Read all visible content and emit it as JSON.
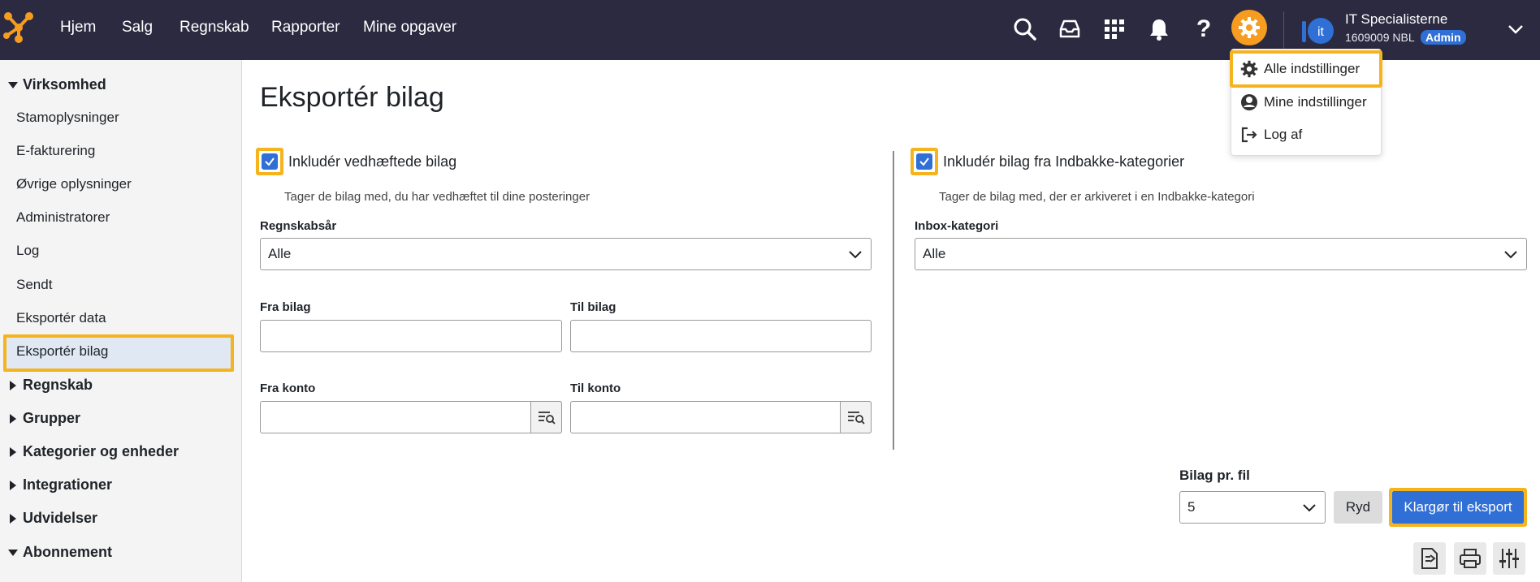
{
  "nav": {
    "items": [
      "Hjem",
      "Salg",
      "Regnskab",
      "Rapporter",
      "Mine opgaver"
    ]
  },
  "icons": {
    "topbar": [
      "search-icon",
      "inbox-icon",
      "apps-grid-icon",
      "bell-icon",
      "help-icon",
      "gear-icon",
      "chevron-down-icon"
    ],
    "accent_color": "#f59c21",
    "primary_color": "#2f6fd6",
    "highlight_color": "#f5b41e"
  },
  "user": {
    "company_name": "IT Specialisterne",
    "company_id": "1609009 NBL",
    "role_badge": "Admin",
    "avatar_initials": "it"
  },
  "settings_menu": {
    "items": [
      "Alle indstillinger",
      "Mine indstillinger",
      "Log af"
    ]
  },
  "sidebar": {
    "sections": [
      {
        "label": "Virksomhed",
        "expanded": true
      },
      {
        "label": "Regnskab",
        "expanded": false
      },
      {
        "label": "Grupper",
        "expanded": false
      },
      {
        "label": "Kategorier og enheder",
        "expanded": false
      },
      {
        "label": "Integrationer",
        "expanded": false
      },
      {
        "label": "Udvidelser",
        "expanded": false
      },
      {
        "label": "Abonnement",
        "expanded": true
      }
    ],
    "items": [
      "Stamoplysninger",
      "E-fakturering",
      "Øvrige oplysninger",
      "Administratorer",
      "Log",
      "Sendt",
      "Eksportér data",
      "Eksportér bilag"
    ],
    "active_item": "Eksportér bilag"
  },
  "main": {
    "title": "Eksportér bilag",
    "left": {
      "checkbox_label": "Inkludér vedhæftede bilag",
      "checked": true,
      "help": "Tager de bilag med, du har vedhæftet til dine posteringer",
      "fiscal_year_label": "Regnskabsår",
      "fiscal_year_value": "Alle",
      "from_voucher_label": "Fra bilag",
      "from_voucher_value": "",
      "to_voucher_label": "Til bilag",
      "to_voucher_value": "",
      "from_account_label": "Fra konto",
      "from_account_value": "",
      "to_account_label": "Til konto",
      "to_account_value": ""
    },
    "right": {
      "checkbox_label": "Inkludér bilag fra Indbakke-kategorier",
      "checked": true,
      "help": "Tager de bilag med, der er arkiveret i en Indbakke-kategori",
      "inbox_category_label": "Inbox-kategori",
      "inbox_category_value": "Alle"
    },
    "per_file_label": "Bilag pr. fil",
    "per_file_value": "5",
    "clear_button": "Ryd",
    "export_button": "Klargør til eksport",
    "tool_icons": [
      "export-file-icon",
      "print-icon",
      "sliders-icon"
    ]
  }
}
